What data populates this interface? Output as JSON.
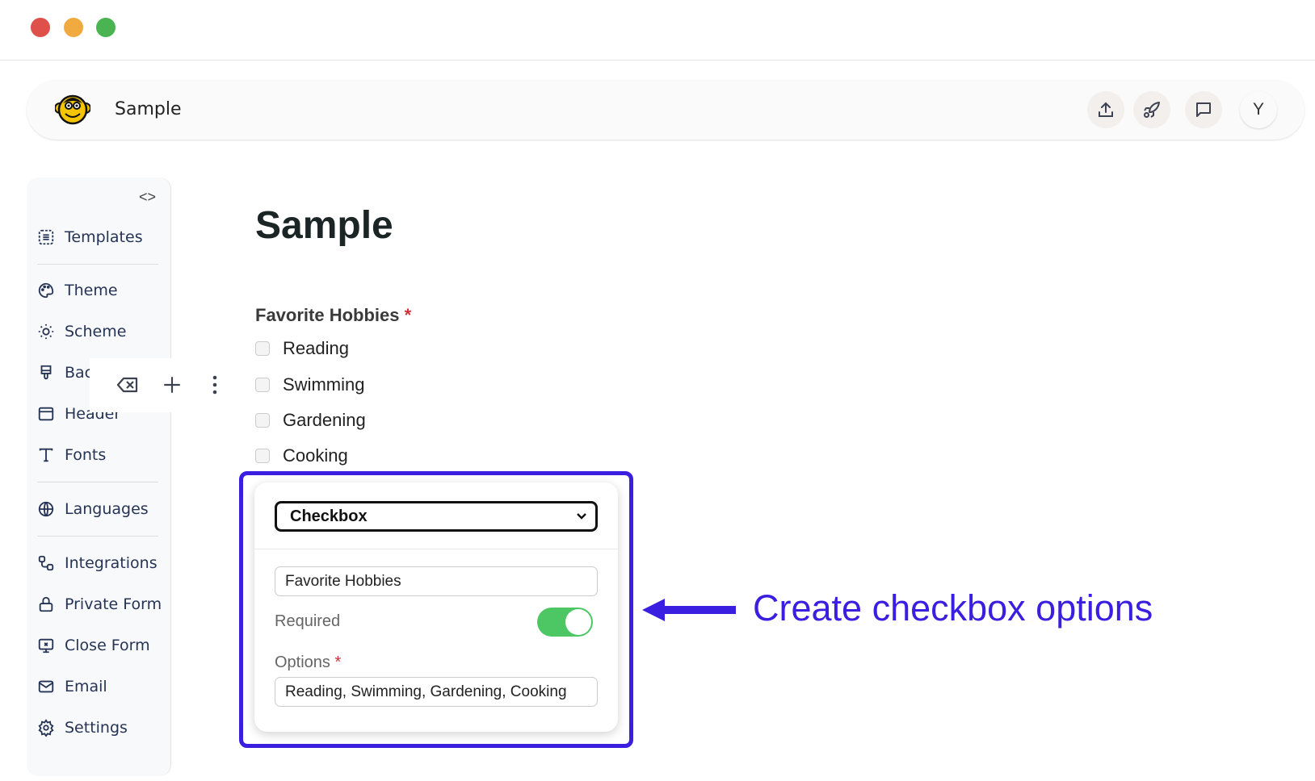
{
  "window": {
    "controls": {
      "close_color": "#e0504a",
      "minimize_color": "#f0aa3f",
      "maximize_color": "#4bb452"
    }
  },
  "header": {
    "app_title": "Sample",
    "avatar_initial": "Y",
    "icons": [
      "upload-icon",
      "rocket-icon",
      "chat-icon"
    ]
  },
  "sidebar": {
    "items": [
      {
        "label": "Templates",
        "icon": "templates-icon"
      },
      {
        "label": "Theme",
        "icon": "palette-icon"
      },
      {
        "label": "Scheme",
        "icon": "sun-moon-icon"
      },
      {
        "label": "Bac",
        "icon": "brush-icon"
      },
      {
        "label": "Header",
        "icon": "layout-icon"
      },
      {
        "label": "Fonts",
        "icon": "type-icon"
      },
      {
        "label": "Languages",
        "icon": "globe-icon"
      },
      {
        "label": "Integrations",
        "icon": "integrations-icon"
      },
      {
        "label": "Private Form",
        "icon": "lock-icon"
      },
      {
        "label": "Close Form",
        "icon": "monitor-x-icon"
      },
      {
        "label": "Email",
        "icon": "mail-icon"
      },
      {
        "label": "Settings",
        "icon": "gear-icon"
      }
    ]
  },
  "form": {
    "title": "Sample",
    "question": {
      "label": "Favorite Hobbies",
      "required_mark": "*",
      "options": [
        "Reading",
        "Swimming",
        "Gardening",
        "Cooking"
      ]
    }
  },
  "editor": {
    "field_type": "Checkbox",
    "label_value": "Favorite Hobbies",
    "required_label": "Required",
    "required_on": true,
    "options_label": "Options",
    "options_required_mark": "*",
    "options_value": "Reading, Swimming, Gardening, Cooking"
  },
  "annotation": {
    "text": "Create checkbox options",
    "color": "#3b1fe0"
  }
}
